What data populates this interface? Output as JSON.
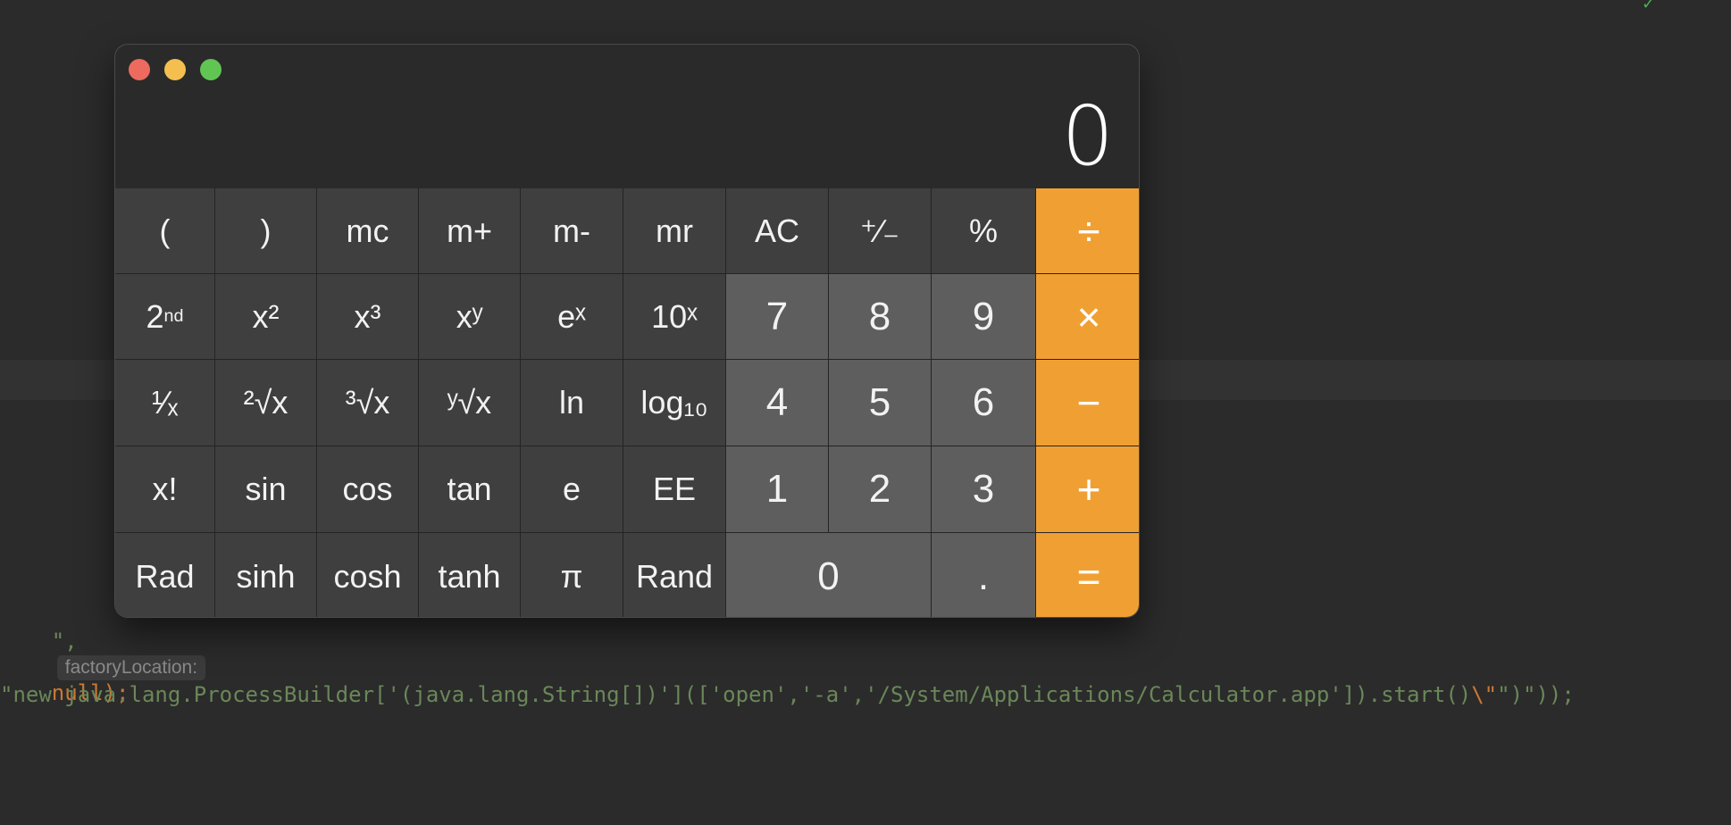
{
  "editor": {
    "line1": {
      "prefix": "\",",
      "hint": "factoryLocation:",
      "suffix": "null);"
    },
    "line2": {
      "text": "\"new java.lang.ProcessBuilder['(java.lang.String[])'](['open','-a','/System/Applications/Calculator.app']).start()",
      "escape": "\\\"",
      "tail": "\")\"));"
    }
  },
  "calculator": {
    "display_value": "0",
    "traffic_lights": {
      "close": "#ed6a5e",
      "minimize": "#f5bf4f",
      "zoom": "#61c554"
    },
    "colors": {
      "function_key": "#3f3f3f",
      "digit_key": "#5e5e5e",
      "operator_key": "#f0a033"
    },
    "rows": [
      [
        "(",
        ")",
        "mc",
        "m+",
        "m-",
        "mr",
        "AC",
        "⁺∕₋",
        "%",
        "÷"
      ],
      [
        "2nd",
        "x²",
        "x³",
        "xʸ",
        "eˣ",
        "10ˣ",
        "7",
        "8",
        "9",
        "×"
      ],
      [
        "¹∕ₓ",
        "²√x",
        "³√x",
        "ʸ√x",
        "ln",
        "log₁₀",
        "4",
        "5",
        "6",
        "−"
      ],
      [
        "x!",
        "sin",
        "cos",
        "tan",
        "e",
        "EE",
        "1",
        "2",
        "3",
        "+"
      ],
      [
        "Rad",
        "sinh",
        "cosh",
        "tanh",
        "π",
        "Rand",
        "0",
        ".",
        "="
      ]
    ]
  }
}
